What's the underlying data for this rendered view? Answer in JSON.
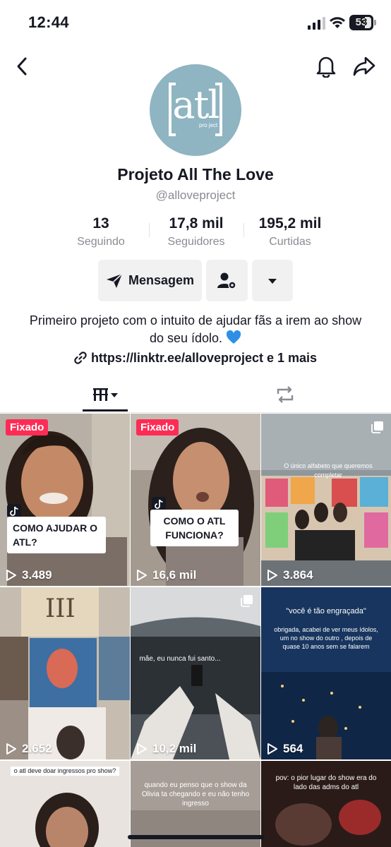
{
  "status_bar": {
    "time": "12:44",
    "battery": "53"
  },
  "profile": {
    "display_name": "Projeto All The Love",
    "username": "@alloveproject",
    "avatar_logo_text": "atl",
    "avatar_logo_sub": "pro ject",
    "bio": "Primeiro projeto com o intuito de ajudar fãs a irem ao show do seu ídolo.",
    "link": "https://linktr.ee/alloveproject e 1 mais"
  },
  "stats": {
    "following": {
      "value": "13",
      "label": "Seguindo"
    },
    "followers": {
      "value": "17,8 mil",
      "label": "Seguidores"
    },
    "likes": {
      "value": "195,2 mil",
      "label": "Curtidas"
    }
  },
  "actions": {
    "message_label": "Mensagem"
  },
  "videos": [
    {
      "pinned_label": "Fixado",
      "caption": "COMO AJUDAR O ATL?",
      "views": "3.489"
    },
    {
      "pinned_label": "Fixado",
      "caption": "COMO O ATL FUNCIONA?",
      "views": "16,6 mil"
    },
    {
      "overlay": "O único alfabeto que queremos completar",
      "views": "3.864"
    },
    {
      "views": "2.652"
    },
    {
      "overlay": "mãe, eu nunca fui santo...",
      "views": "10,2 mil"
    },
    {
      "overlay": "\"você é tão engraçada\"",
      "overlay2": "obrigada, acabei de ver meus ídolos, um no show do outro , depois de quase 10 anos sem se falarem",
      "views": "564"
    },
    {
      "overlay": "o atl deve doar ingressos pro show?"
    },
    {
      "overlay": "quando eu penso que o show da Olivia ta chegando e eu não tenho ingresso"
    },
    {
      "overlay": "pov: o pior lugar do show era do lado das adms do atl"
    }
  ]
}
